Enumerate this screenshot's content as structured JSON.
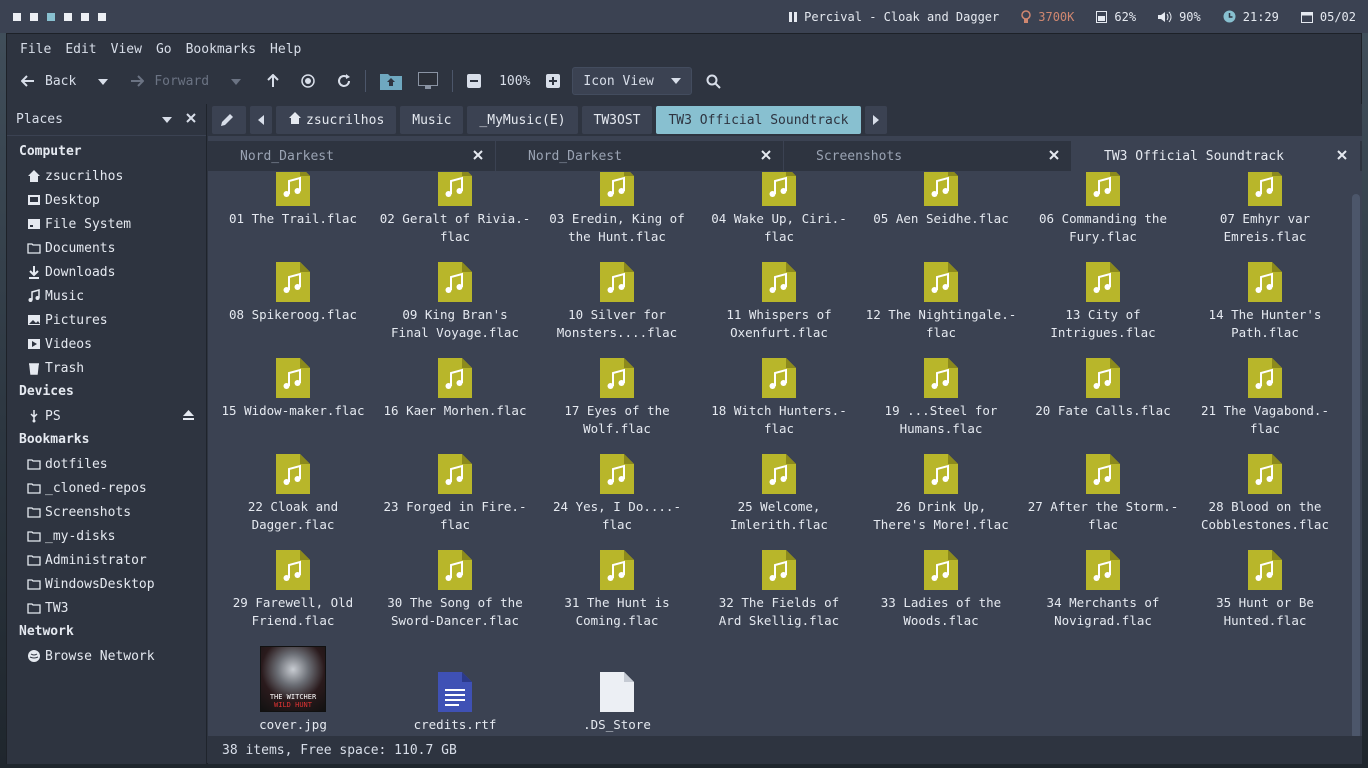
{
  "topbar": {
    "workspaces": [
      false,
      false,
      true,
      false,
      false,
      false
    ],
    "now_playing": "Percival - Cloak and Dagger",
    "temp": "3700K",
    "battery": "62%",
    "volume": "90%",
    "time": "21:29",
    "date": "05/02"
  },
  "menu": [
    "File",
    "Edit",
    "View",
    "Go",
    "Bookmarks",
    "Help"
  ],
  "toolbar": {
    "back": "Back",
    "forward": "Forward",
    "zoom": "100%",
    "view": "Icon View"
  },
  "sidebar": {
    "header": "Places",
    "computer": {
      "title": "Computer",
      "items": [
        {
          "label": "zsucrilhos",
          "icon": "home-icon"
        },
        {
          "label": "Desktop",
          "icon": "desktop-icon"
        },
        {
          "label": "File System",
          "icon": "drive-icon"
        },
        {
          "label": "Documents",
          "icon": "folder-icon"
        },
        {
          "label": "Downloads",
          "icon": "download-icon"
        },
        {
          "label": "Music",
          "icon": "music-icon"
        },
        {
          "label": "Pictures",
          "icon": "pictures-icon"
        },
        {
          "label": "Videos",
          "icon": "videos-icon"
        },
        {
          "label": "Trash",
          "icon": "trash-icon"
        }
      ]
    },
    "devices": {
      "title": "Devices",
      "items": [
        {
          "label": "PS",
          "icon": "usb-icon"
        }
      ]
    },
    "bookmarks": {
      "title": "Bookmarks",
      "items": [
        {
          "label": "dotfiles"
        },
        {
          "label": "_cloned-repos"
        },
        {
          "label": "Screenshots"
        },
        {
          "label": "_my-disks"
        },
        {
          "label": "Administrator"
        },
        {
          "label": "WindowsDesktop"
        },
        {
          "label": "TW3"
        }
      ]
    },
    "network": {
      "title": "Network",
      "items": [
        {
          "label": "Browse Network",
          "icon": "network-icon"
        }
      ]
    }
  },
  "path": [
    "zsucrilhos",
    "Music",
    "_MyMusic(E)",
    "TW3OST",
    "TW3 Official Soundtrack"
  ],
  "tabs": [
    "Nord_Darkest",
    "Nord_Darkest",
    "Screenshots",
    "TW3 Official Soundtrack"
  ],
  "files": [
    [
      "01 The Trail.flac"
    ],
    [
      "02 Geralt of Rivia.-",
      "flac"
    ],
    [
      "03 Eredin, King of",
      "the Hunt.flac"
    ],
    [
      "04 Wake Up, Ciri.-",
      "flac"
    ],
    [
      "05 Aen Seidhe.flac"
    ],
    [
      "06 Commanding the",
      "Fury.flac"
    ],
    [
      "07 Emhyr var",
      "Emreis.flac"
    ],
    [
      "08 Spikeroog.flac"
    ],
    [
      "09 King Bran's",
      "Final Voyage.flac"
    ],
    [
      "10 Silver for",
      "Monsters....flac"
    ],
    [
      "11 Whispers of",
      "Oxenfurt.flac"
    ],
    [
      "12 The Nightingale.-",
      "flac"
    ],
    [
      "13 City of",
      "Intrigues.flac"
    ],
    [
      "14 The Hunter's",
      "Path.flac"
    ],
    [
      "15 Widow-maker.flac"
    ],
    [
      "16 Kaer Morhen.flac"
    ],
    [
      "17 Eyes of the",
      "Wolf.flac"
    ],
    [
      "18 Witch Hunters.-",
      "flac"
    ],
    [
      "19 ...Steel for",
      "Humans.flac"
    ],
    [
      "20 Fate Calls.flac"
    ],
    [
      "21 The Vagabond.-",
      "flac"
    ],
    [
      "22 Cloak and",
      "Dagger.flac"
    ],
    [
      "23 Forged in Fire.-",
      "flac"
    ],
    [
      "24 Yes, I Do....-",
      "flac"
    ],
    [
      "25 Welcome,",
      "Imlerith.flac"
    ],
    [
      "26 Drink Up,",
      "There's More!.flac"
    ],
    [
      "27 After the Storm.-",
      "flac"
    ],
    [
      "28 Blood on the",
      "Cobblestones.flac"
    ],
    [
      "29 Farewell, Old",
      "Friend.flac"
    ],
    [
      "30 The Song of the",
      "Sword-Dancer.flac"
    ],
    [
      "31 The Hunt is",
      "Coming.flac"
    ],
    [
      "32 The Fields of",
      "Ard Skellig.flac"
    ],
    [
      "33 Ladies of the",
      "Woods.flac"
    ],
    [
      "34 Merchants of",
      "Novigrad.flac"
    ],
    [
      "35 Hunt or Be",
      "Hunted.flac"
    ]
  ],
  "others": [
    {
      "name": "cover.jpg",
      "kind": "image",
      "art_title": "THE WITCHER",
      "art_sub": "WILD HUNT"
    },
    {
      "name": "credits.rtf",
      "kind": "doc"
    },
    {
      "name": ".DS_Store",
      "kind": "blank"
    }
  ],
  "status": "38 items, Free space: 110.7 GB",
  "colors": {
    "accent": "#88c0d0",
    "audio": "#b8b62a"
  }
}
